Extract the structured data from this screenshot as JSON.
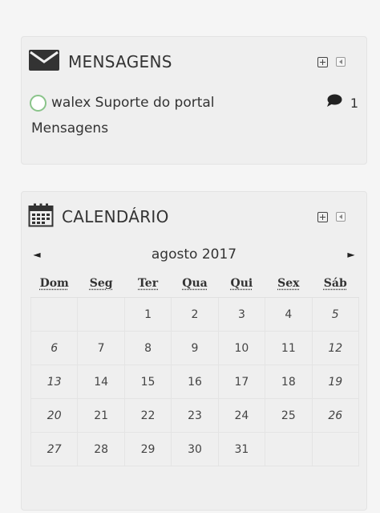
{
  "messages": {
    "title": "MENSAGENS",
    "user": "walex Suporte do portal",
    "count": "1",
    "link": "Mensagens"
  },
  "calendar": {
    "title": "CALENDÁRIO",
    "month_label": "agosto 2017",
    "prev_arrow": "◄",
    "next_arrow": "►",
    "weekdays": [
      "Dom",
      "Seg",
      "Ter",
      "Qua",
      "Qui",
      "Sex",
      "Sáb"
    ],
    "weeks": [
      [
        "",
        "",
        "1",
        "2",
        "3",
        "4",
        "5"
      ],
      [
        "6",
        "7",
        "8",
        "9",
        "10",
        "11",
        "12"
      ],
      [
        "13",
        "14",
        "15",
        "16",
        "17",
        "18",
        "19"
      ],
      [
        "20",
        "21",
        "22",
        "23",
        "24",
        "25",
        "26"
      ],
      [
        "27",
        "28",
        "29",
        "30",
        "31",
        "",
        ""
      ]
    ]
  },
  "colors": {
    "avatar_ring": "#8ac48a",
    "block_bg": "#efefef"
  }
}
